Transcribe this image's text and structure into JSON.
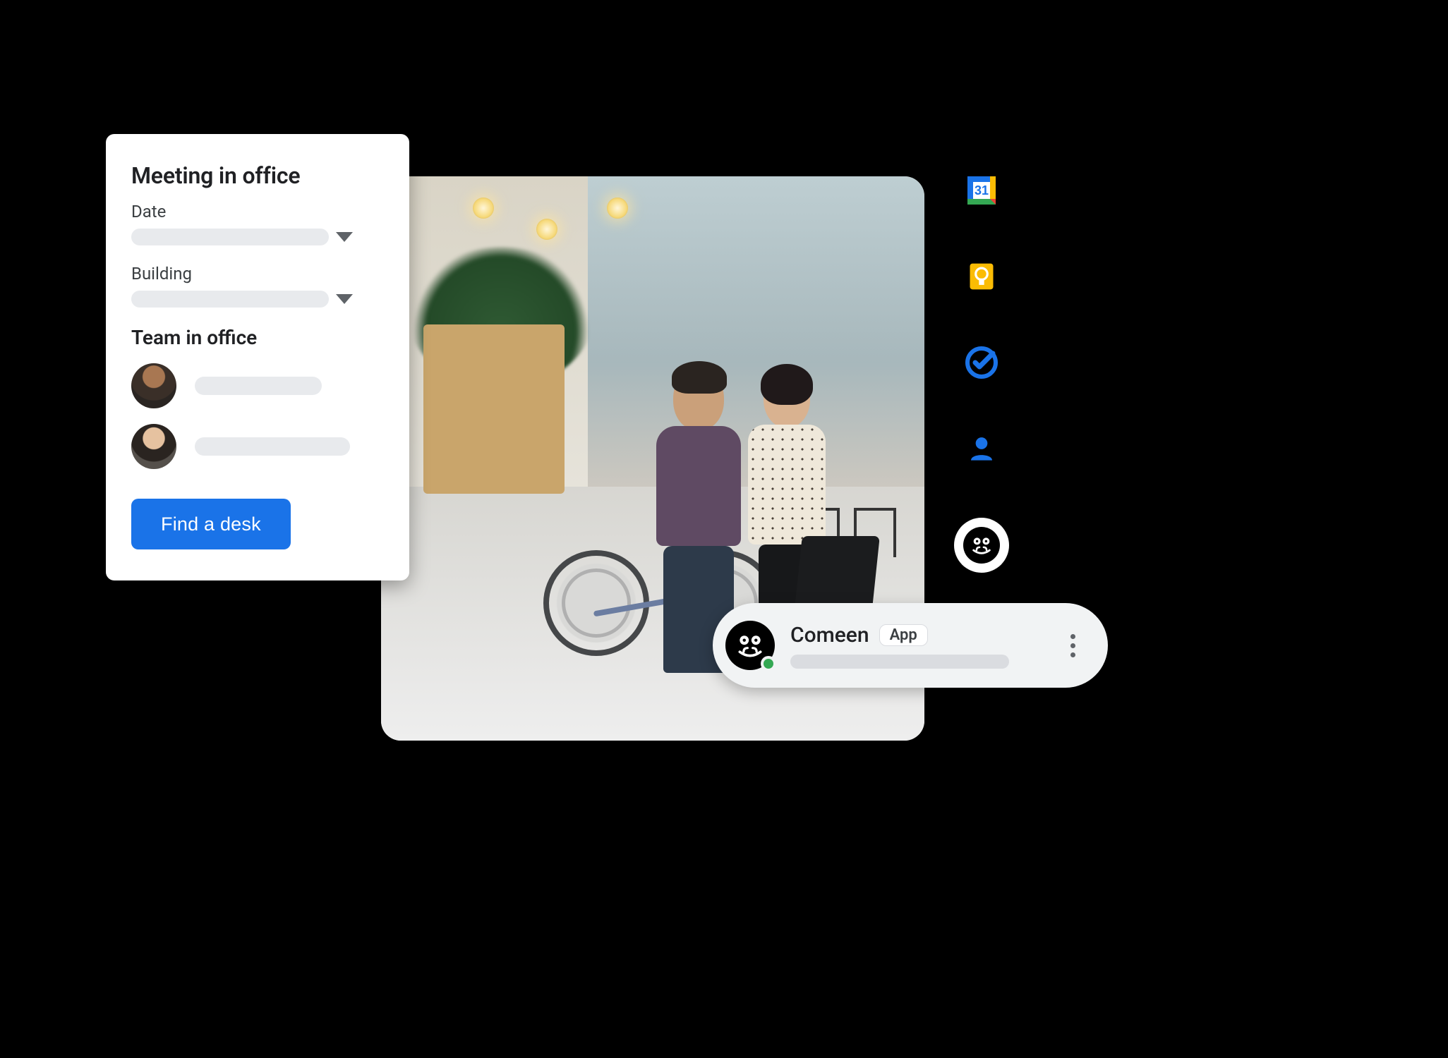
{
  "card": {
    "title": "Meeting in office",
    "date_label": "Date",
    "building_label": "Building",
    "team_title": "Team in office",
    "button_label": "Find a desk"
  },
  "chat": {
    "app_name": "Comeen",
    "badge": "App"
  },
  "rail": {
    "icons": [
      "calendar",
      "keep",
      "tasks",
      "contacts",
      "comeen"
    ],
    "calendar_day": "31"
  },
  "colors": {
    "primary_blue": "#1a73e8",
    "google_yellow": "#fbbc04",
    "google_green": "#34a853",
    "google_red": "#ea4335"
  }
}
